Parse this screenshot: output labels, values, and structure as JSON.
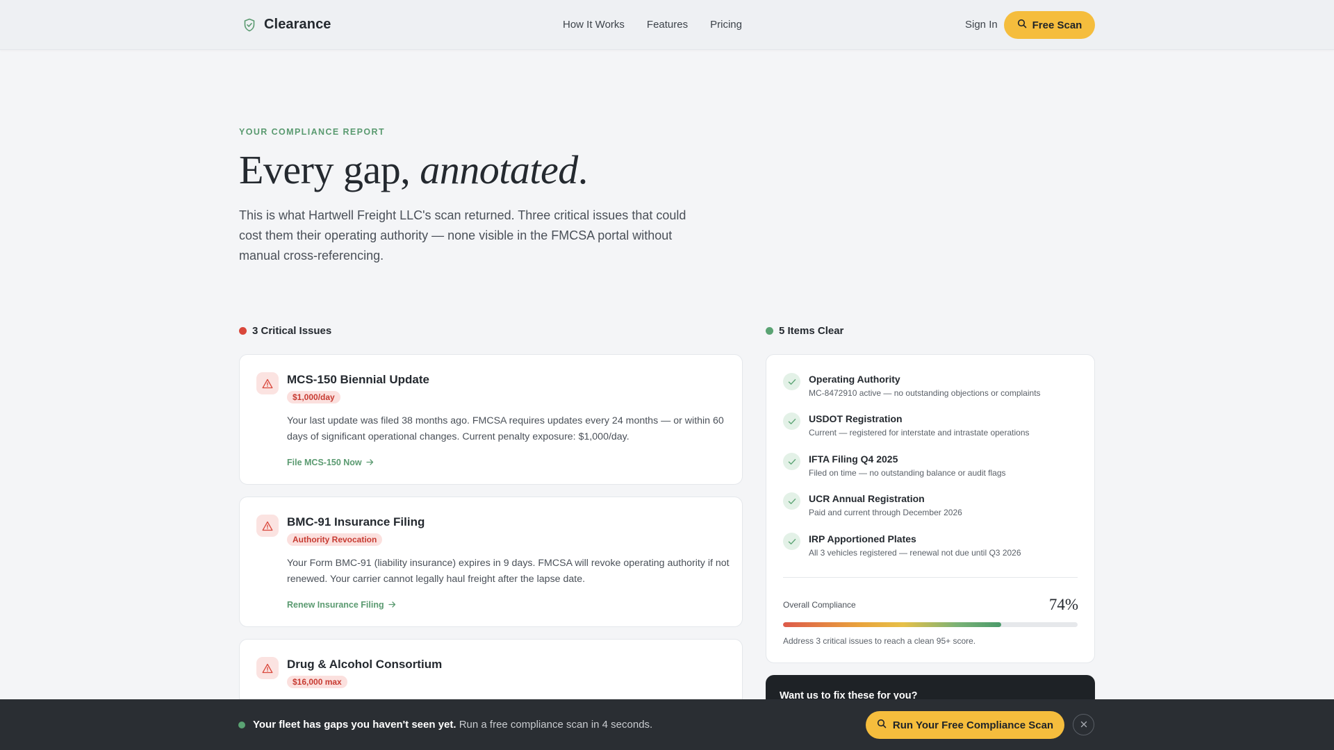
{
  "nav": {
    "brand": "Clearance",
    "links": [
      "How It Works",
      "Features",
      "Pricing"
    ],
    "sign_in": "Sign In",
    "cta": "Free Scan"
  },
  "hero": {
    "eyebrow": "YOUR COMPLIANCE REPORT",
    "headline_plain": "Every gap, ",
    "headline_italic": "annotated",
    "headline_end": ".",
    "lead": "This is what Hartwell Freight LLC's scan returned. Three critical issues that could cost them their operating authority — none visible in the FMCSA portal without manual cross-referencing."
  },
  "issues": {
    "heading": "3 Critical Issues",
    "status_color": "#d9473b",
    "items": [
      {
        "title": "MCS-150 Biennial Update",
        "badge": "$1,000/day",
        "body": "Your last update was filed 38 months ago. FMCSA requires updates every 24 months — or within 60 days of significant operational changes. Current penalty exposure: $1,000/day.",
        "link": "File MCS-150 Now"
      },
      {
        "title": "BMC-91 Insurance Filing",
        "badge": "Authority Revocation",
        "body": "Your Form BMC-91 (liability insurance) expires in 9 days. FMCSA will revoke operating authority if not renewed. Your carrier cannot legally haul freight after the lapse date.",
        "link": "Renew Insurance Filing"
      },
      {
        "title": "Drug & Alcohol Consortium",
        "badge": "$16,000 max",
        "body": "",
        "link": ""
      }
    ]
  },
  "clear": {
    "heading": "5 Items Clear",
    "status_color": "#5aa373",
    "items": [
      {
        "title": "Operating Authority",
        "detail": "MC-8472910 active — no outstanding objections or complaints"
      },
      {
        "title": "USDOT Registration",
        "detail": "Current — registered for interstate and intrastate operations"
      },
      {
        "title": "IFTA Filing Q4 2025",
        "detail": "Filed on time — no outstanding balance or audit flags"
      },
      {
        "title": "UCR Annual Registration",
        "detail": "Paid and current through December 2026"
      },
      {
        "title": "IRP Apportioned Plates",
        "detail": "All 3 vehicles registered — renewal not due until Q3 2026"
      }
    ],
    "overall_label": "Overall Compliance",
    "overall_value": "74%",
    "overall_fraction": 0.74,
    "overall_note": "Address 3 critical issues to reach a clean 95+ score."
  },
  "fix_card": {
    "title": "Want us to fix these for you?"
  },
  "bottom_bar": {
    "strong": "Your fleet has gaps you haven't seen yet.",
    "text": " Run a free compliance scan in 4 seconds.",
    "cta": "Run Your Free Compliance Scan"
  },
  "colors": {
    "accent": "#f5bd3d",
    "brand_green": "#5a9a70",
    "critical": "#d9473b"
  }
}
